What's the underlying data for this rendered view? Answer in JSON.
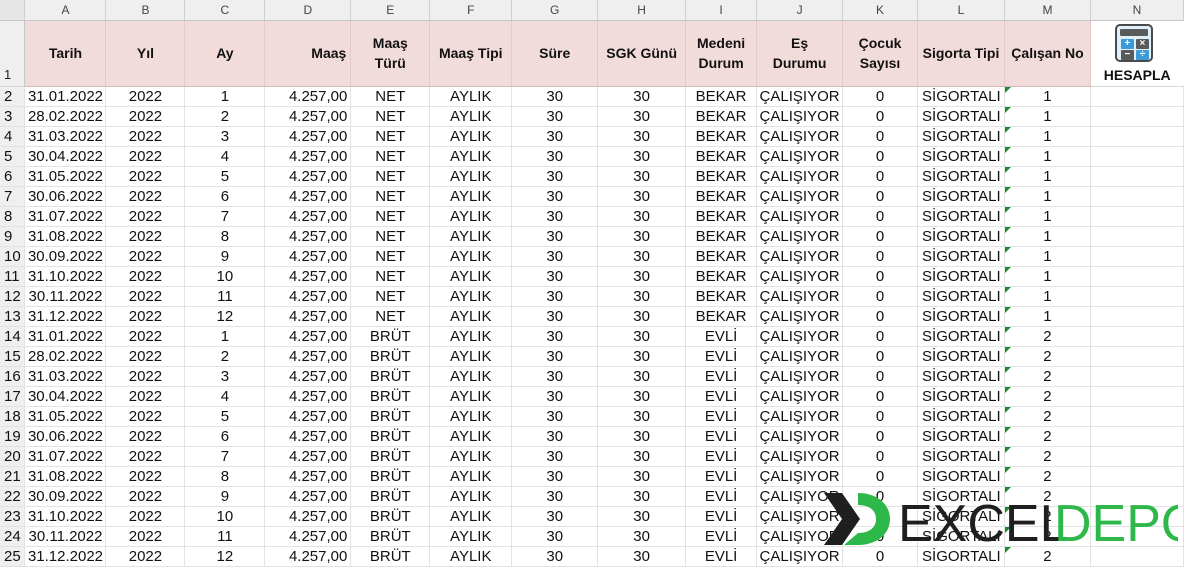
{
  "columns": [
    "A",
    "B",
    "C",
    "D",
    "E",
    "F",
    "G",
    "H",
    "I",
    "J",
    "K",
    "L",
    "M",
    "N"
  ],
  "headers": {
    "tarih": "Tarih",
    "yil": "Yıl",
    "ay": "Ay",
    "maas": "Maaş",
    "maas_turu_1": "Maaş",
    "maas_turu_2": "Türü",
    "maas_tipi": "Maaş Tipi",
    "sure": "Süre",
    "sgk_gunu": "SGK Günü",
    "medeni_1": "Medeni",
    "medeni_2": "Durum",
    "es_1": "Eş",
    "es_2": "Durumu",
    "cocuk_1": "Çocuk",
    "cocuk_2": "Sayısı",
    "sigorta_tipi": "Sigorta Tipi",
    "calisan_no": "Çalışan No"
  },
  "calc_button": {
    "label": "HESAPLA",
    "icon": "calculator-icon"
  },
  "rows": [
    [
      "31.01.2022",
      "2022",
      "1",
      "4.257,00",
      "NET",
      "AYLIK",
      "30",
      "30",
      "BEKAR",
      "ÇALIŞIYOR",
      "0",
      "SİGORTALI",
      "1"
    ],
    [
      "28.02.2022",
      "2022",
      "2",
      "4.257,00",
      "NET",
      "AYLIK",
      "30",
      "30",
      "BEKAR",
      "ÇALIŞIYOR",
      "0",
      "SİGORTALI",
      "1"
    ],
    [
      "31.03.2022",
      "2022",
      "3",
      "4.257,00",
      "NET",
      "AYLIK",
      "30",
      "30",
      "BEKAR",
      "ÇALIŞIYOR",
      "0",
      "SİGORTALI",
      "1"
    ],
    [
      "30.04.2022",
      "2022",
      "4",
      "4.257,00",
      "NET",
      "AYLIK",
      "30",
      "30",
      "BEKAR",
      "ÇALIŞIYOR",
      "0",
      "SİGORTALI",
      "1"
    ],
    [
      "31.05.2022",
      "2022",
      "5",
      "4.257,00",
      "NET",
      "AYLIK",
      "30",
      "30",
      "BEKAR",
      "ÇALIŞIYOR",
      "0",
      "SİGORTALI",
      "1"
    ],
    [
      "30.06.2022",
      "2022",
      "6",
      "4.257,00",
      "NET",
      "AYLIK",
      "30",
      "30",
      "BEKAR",
      "ÇALIŞIYOR",
      "0",
      "SİGORTALI",
      "1"
    ],
    [
      "31.07.2022",
      "2022",
      "7",
      "4.257,00",
      "NET",
      "AYLIK",
      "30",
      "30",
      "BEKAR",
      "ÇALIŞIYOR",
      "0",
      "SİGORTALI",
      "1"
    ],
    [
      "31.08.2022",
      "2022",
      "8",
      "4.257,00",
      "NET",
      "AYLIK",
      "30",
      "30",
      "BEKAR",
      "ÇALIŞIYOR",
      "0",
      "SİGORTALI",
      "1"
    ],
    [
      "30.09.2022",
      "2022",
      "9",
      "4.257,00",
      "NET",
      "AYLIK",
      "30",
      "30",
      "BEKAR",
      "ÇALIŞIYOR",
      "0",
      "SİGORTALI",
      "1"
    ],
    [
      "31.10.2022",
      "2022",
      "10",
      "4.257,00",
      "NET",
      "AYLIK",
      "30",
      "30",
      "BEKAR",
      "ÇALIŞIYOR",
      "0",
      "SİGORTALI",
      "1"
    ],
    [
      "30.11.2022",
      "2022",
      "11",
      "4.257,00",
      "NET",
      "AYLIK",
      "30",
      "30",
      "BEKAR",
      "ÇALIŞIYOR",
      "0",
      "SİGORTALI",
      "1"
    ],
    [
      "31.12.2022",
      "2022",
      "12",
      "4.257,00",
      "NET",
      "AYLIK",
      "30",
      "30",
      "BEKAR",
      "ÇALIŞIYOR",
      "0",
      "SİGORTALI",
      "1"
    ],
    [
      "31.01.2022",
      "2022",
      "1",
      "4.257,00",
      "BRÜT",
      "AYLIK",
      "30",
      "30",
      "EVLİ",
      "ÇALIŞIYOR",
      "0",
      "SİGORTALI",
      "2"
    ],
    [
      "28.02.2022",
      "2022",
      "2",
      "4.257,00",
      "BRÜT",
      "AYLIK",
      "30",
      "30",
      "EVLİ",
      "ÇALIŞIYOR",
      "0",
      "SİGORTALI",
      "2"
    ],
    [
      "31.03.2022",
      "2022",
      "3",
      "4.257,00",
      "BRÜT",
      "AYLIK",
      "30",
      "30",
      "EVLİ",
      "ÇALIŞIYOR",
      "0",
      "SİGORTALI",
      "2"
    ],
    [
      "30.04.2022",
      "2022",
      "4",
      "4.257,00",
      "BRÜT",
      "AYLIK",
      "30",
      "30",
      "EVLİ",
      "ÇALIŞIYOR",
      "0",
      "SİGORTALI",
      "2"
    ],
    [
      "31.05.2022",
      "2022",
      "5",
      "4.257,00",
      "BRÜT",
      "AYLIK",
      "30",
      "30",
      "EVLİ",
      "ÇALIŞIYOR",
      "0",
      "SİGORTALI",
      "2"
    ],
    [
      "30.06.2022",
      "2022",
      "6",
      "4.257,00",
      "BRÜT",
      "AYLIK",
      "30",
      "30",
      "EVLİ",
      "ÇALIŞIYOR",
      "0",
      "SİGORTALI",
      "2"
    ],
    [
      "31.07.2022",
      "2022",
      "7",
      "4.257,00",
      "BRÜT",
      "AYLIK",
      "30",
      "30",
      "EVLİ",
      "ÇALIŞIYOR",
      "0",
      "SİGORTALI",
      "2"
    ],
    [
      "31.08.2022",
      "2022",
      "8",
      "4.257,00",
      "BRÜT",
      "AYLIK",
      "30",
      "30",
      "EVLİ",
      "ÇALIŞIYOR",
      "0",
      "SİGORTALI",
      "2"
    ],
    [
      "30.09.2022",
      "2022",
      "9",
      "4.257,00",
      "BRÜT",
      "AYLIK",
      "30",
      "30",
      "EVLİ",
      "ÇALIŞIYOR",
      "0",
      "SİGORTALI",
      "2"
    ],
    [
      "31.10.2022",
      "2022",
      "10",
      "4.257,00",
      "BRÜT",
      "AYLIK",
      "30",
      "30",
      "EVLİ",
      "ÇALIŞIYOR",
      "0",
      "SİGORTALI",
      "2"
    ],
    [
      "30.11.2022",
      "2022",
      "11",
      "4.257,00",
      "BRÜT",
      "AYLIK",
      "30",
      "30",
      "EVLİ",
      "ÇALIŞIYOR",
      "0",
      "SİGORTALI",
      "2"
    ],
    [
      "31.12.2022",
      "2022",
      "12",
      "4.257,00",
      "BRÜT",
      "AYLIK",
      "30",
      "30",
      "EVLİ",
      "ÇALIŞIYOR",
      "0",
      "SİGORTALI",
      "2"
    ]
  ],
  "watermark": {
    "part1": "EXCEL",
    "part2": "DEPO",
    "color_dark": "#1f1f1f",
    "color_green": "#2fb84a"
  },
  "colors": {
    "header_fill": "#f2dcdb",
    "grid": "#e2e2e2",
    "indicator": "#1e8a2e"
  }
}
